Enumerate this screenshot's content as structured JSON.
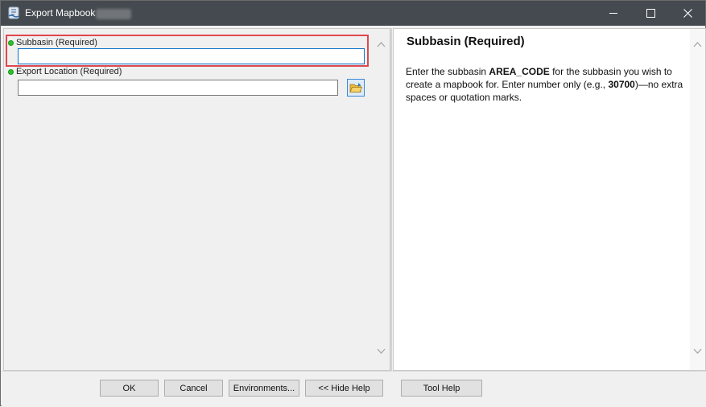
{
  "window": {
    "title": "Export Mapbook",
    "controls": {
      "minimize": "minimize",
      "maximize": "maximize",
      "close": "close"
    }
  },
  "params": [
    {
      "label": "Subbasin (Required)",
      "value": "",
      "required": true
    },
    {
      "label": "Export Location (Required)",
      "value": "",
      "required": true
    }
  ],
  "help": {
    "title": "Subbasin (Required)",
    "text_1": "Enter the subbasin ",
    "bold_1": "AREA_CODE",
    "text_2": " for the subbasin you wish to create a mapbook for. Enter number only (e.g., ",
    "bold_2": "30700",
    "text_3": ")—no extra spaces or quotation marks."
  },
  "buttons": {
    "ok": "OK",
    "cancel": "Cancel",
    "environments": "Environments...",
    "hide_help": "<< Hide Help",
    "tool_help": "Tool Help"
  },
  "colors": {
    "titlebar": "#444a4f",
    "highlight": "#e0474e",
    "required_dot": "#2ec02e"
  }
}
